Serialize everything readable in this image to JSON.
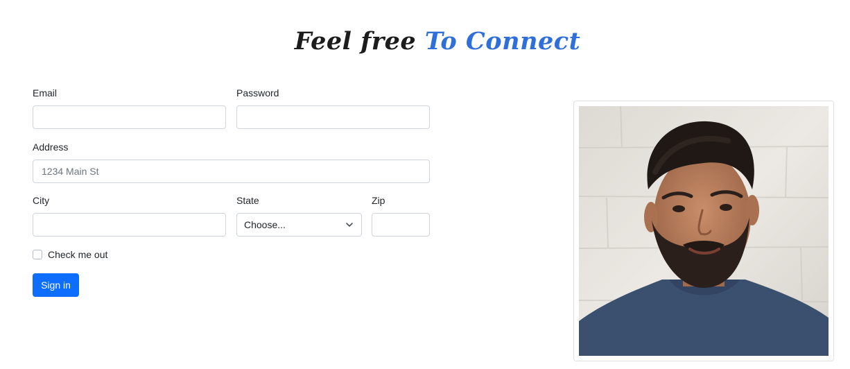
{
  "heading": {
    "part1": "Feel free ",
    "part2": "To Connect"
  },
  "form": {
    "email_label": "Email",
    "email_value": "",
    "password_label": "Password",
    "password_value": "",
    "address_label": "Address",
    "address_placeholder": "1234 Main St",
    "city_label": "City",
    "city_value": "",
    "state_label": "State",
    "state_selected": "Choose...",
    "zip_label": "Zip",
    "zip_value": "",
    "checkbox_label": "Check me out",
    "submit_label": "Sign in"
  },
  "colors": {
    "accent": "#2f6fd9",
    "button": "#0d6efd"
  },
  "icons": {
    "select": "chevron-down-icon"
  }
}
